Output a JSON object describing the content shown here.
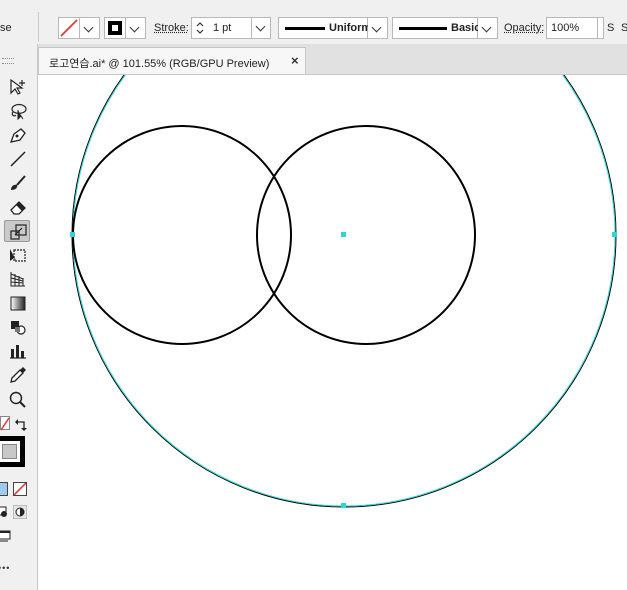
{
  "control_bar": {
    "left_clipped_text": "se",
    "stroke_label": "Stroke:",
    "stroke_weight": "1 pt",
    "profile_label": "Uniform",
    "brush_label": "Basic",
    "opacity_label": "Opacity:",
    "opacity_value": "100%",
    "right_clipped_a": "S",
    "right_clipped_b": "S"
  },
  "document_tab": {
    "title": "로고연습.ai* @ 101.55% (RGB/GPU Preview)",
    "close_glyph": "×"
  },
  "toolbar": {
    "more_glyph": "•••"
  },
  "colors": {
    "selection": "#2fd6d6",
    "fill_none": "#e53935",
    "app_bg": "#f0f0f0",
    "canvas_bg": "#ffffff"
  }
}
